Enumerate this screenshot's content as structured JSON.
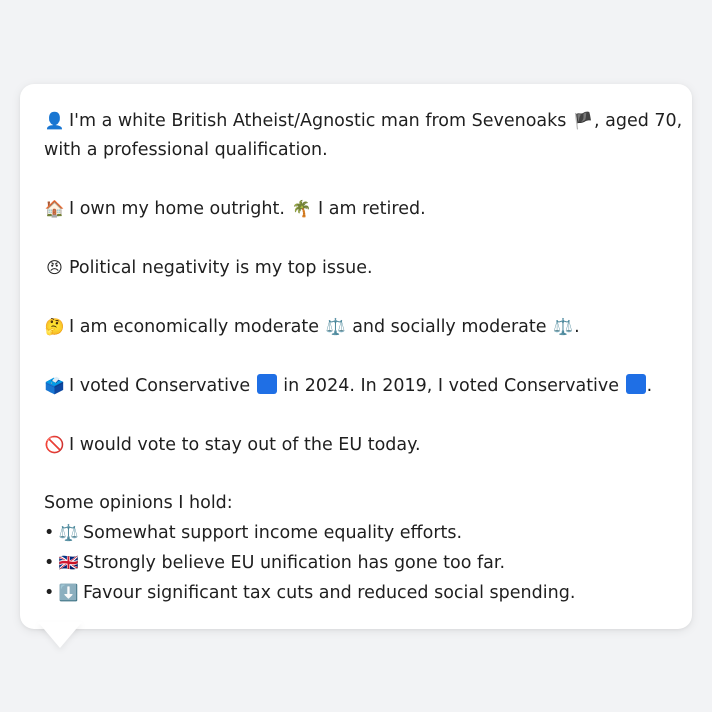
{
  "profile": {
    "p1_line1": {
      "icon": "👤",
      "text_a": "I'm a white British Atheist/Agnostic man from Sevenoaks",
      "flag": "🏴",
      "text_b": ", aged 70,"
    },
    "p1_line2": "with a professional qualification.",
    "p2": {
      "icon": "🏠",
      "text_a": "I own my home outright.",
      "icon2": "🌴",
      "text_b": "I am retired."
    },
    "p3": {
      "icon": "😠",
      "text": "Political negativity is my top issue."
    },
    "p4": {
      "icon": "🤔",
      "text_a": "I am economically moderate",
      "icon_a": "⚖️",
      "text_b": "and socially moderate",
      "icon_b": "⚖️",
      "text_c": "."
    },
    "p5": {
      "icon": "🗳️",
      "text_a": "I voted Conservative",
      "text_b": "in 2024. In 2019, I voted Conservative",
      "text_c": ".",
      "party_color": "#1f6fe5"
    },
    "p6": {
      "icon": "🚫",
      "text": "I would vote to stay out of the EU today."
    },
    "opinions": {
      "heading": "Some opinions I hold:",
      "bullet": "•",
      "items": [
        {
          "icon": "⚖️",
          "text": "Somewhat support income equality efforts."
        },
        {
          "icon": "🇬🇧",
          "text": "Strongly believe EU unification has gone too far."
        },
        {
          "icon": "⬇️",
          "text": "Favour significant tax cuts and reduced social spending."
        }
      ]
    }
  },
  "colors": {
    "background": "#f2f3f5",
    "card": "#ffffff",
    "text": "#1f1f1f"
  }
}
